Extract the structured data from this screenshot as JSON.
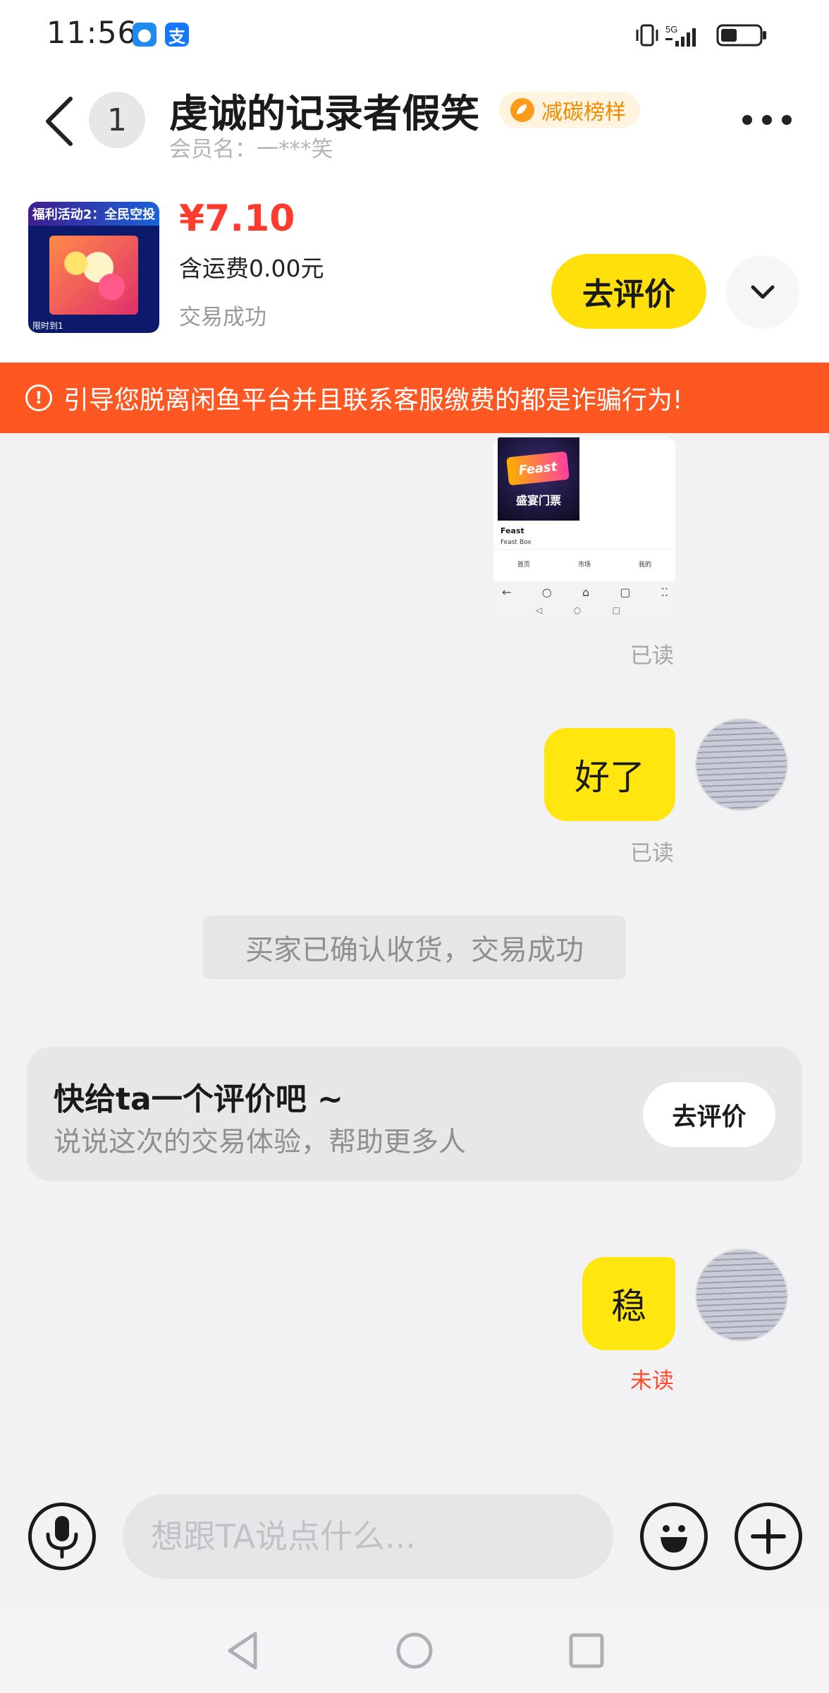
{
  "status_bar": {
    "time": "11:56",
    "app_badges": [
      {
        "icon": "chat-bubble-icon",
        "glyph": "●",
        "color": "#1f8bf0"
      },
      {
        "icon": "alipay-icon",
        "glyph": "支",
        "color": "#1677ff"
      }
    ],
    "network": "5G",
    "icons": [
      "vibrate-icon",
      "signal-icon",
      "battery-icon"
    ]
  },
  "header": {
    "unread_count": "1",
    "contact_name": "虔诚的记录者假笑",
    "badge_label": "减碳榜样",
    "member_name": "会员名：一***笑"
  },
  "product": {
    "thumb_banner": "福利活动2：全民空投",
    "thumb_footer": "限时到1",
    "price": "¥7.10",
    "shipping": "含运费0.00元",
    "status": "交易成功",
    "review_button": "去评价"
  },
  "warning": {
    "text": "引导您脱离闲鱼平台并且联系客服缴费的都是诈骗行为!"
  },
  "messages": {
    "shot": {
      "poster_title": "Feast",
      "poster_text": "盛宴门票",
      "line1": "Feast",
      "line2": "Feast Box",
      "tabs": [
        "首页",
        "市场",
        "我的"
      ],
      "nav_row1": [
        "←",
        "○",
        "⌂",
        "▢",
        "⁚⁚"
      ],
      "nav_row2": [
        "◁",
        "○",
        "□"
      ]
    },
    "read_1": "已读",
    "bubble_1": "好了",
    "read_2": "已读",
    "system_note": "买家已确认收货，交易成功",
    "review_card": {
      "title": "快给ta一个评价吧 ~",
      "subtitle": "说说这次的交易体验，帮助更多人",
      "button": "去评价"
    },
    "bubble_2": "稳",
    "read_3": "未读"
  },
  "input": {
    "placeholder": "想跟TA说点什么..."
  },
  "colors": {
    "accent_yellow": "#ffe00a",
    "warning_orange": "#ff5722",
    "price_red": "#ff3a2e",
    "unread_red": "#ff4a2b"
  }
}
